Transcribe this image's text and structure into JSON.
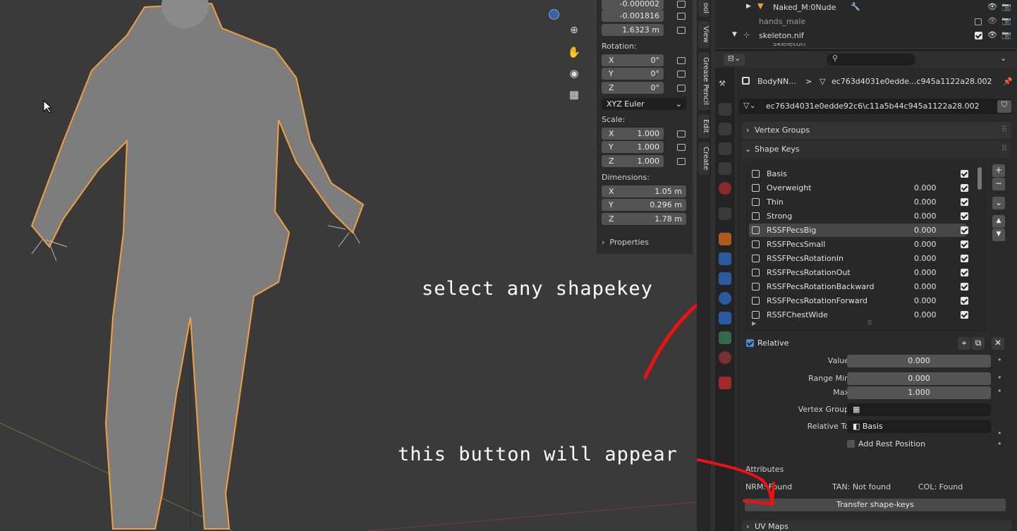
{
  "npanel": {
    "loc": [
      "-0.000002",
      "-0.001816",
      "1.6323 m"
    ],
    "rotation_label": "Rotation:",
    "rotation": [
      {
        "ax": "X",
        "v": "0°"
      },
      {
        "ax": "Y",
        "v": "0°"
      },
      {
        "ax": "Z",
        "v": "0°"
      }
    ],
    "rot_mode": "XYZ Euler",
    "scale_label": "Scale:",
    "scale": [
      {
        "ax": "X",
        "v": "1.000"
      },
      {
        "ax": "Y",
        "v": "1.000"
      },
      {
        "ax": "Z",
        "v": "1.000"
      }
    ],
    "dim_label": "Dimensions:",
    "dims": [
      {
        "ax": "X",
        "v": "1.05 m"
      },
      {
        "ax": "Y",
        "v": "0.296 m"
      },
      {
        "ax": "Z",
        "v": "1.78 m"
      }
    ],
    "properties": "Properties"
  },
  "vtabs": [
    "ool",
    "View",
    "Grease Pencil",
    "Edit",
    "Create"
  ],
  "outliner": [
    "Naked_M:0Nude",
    "hands_male",
    "skeleton.nif",
    "skeleton"
  ],
  "props": {
    "breadcrumb_obj": "BodyNN...",
    "breadcrumb_sep": ">",
    "breadcrumb_mesh": "ec763d4031e0edde...c945a1122a28.002",
    "mesh_name": "ec763d4031e0edde92c6\\c11a5b44c945a1122a28.002",
    "vertex_groups": "Vertex Groups",
    "shape_keys": "Shape Keys",
    "keys": [
      {
        "name": "Basis",
        "value": ""
      },
      {
        "name": "Overweight",
        "value": "0.000"
      },
      {
        "name": "Thin",
        "value": "0.000"
      },
      {
        "name": "Strong",
        "value": "0.000"
      },
      {
        "name": "RSSFPecsBig",
        "value": "0.000"
      },
      {
        "name": "RSSFPecsSmall",
        "value": "0.000"
      },
      {
        "name": "RSSFPecsRotationIn",
        "value": "0.000"
      },
      {
        "name": "RSSFPecsRotationOut",
        "value": "0.000"
      },
      {
        "name": "RSSFPecsRotationBackward",
        "value": "0.000"
      },
      {
        "name": "RSSFPecsRotationForward",
        "value": "0.000"
      },
      {
        "name": "RSSFChestWide",
        "value": "0.000"
      }
    ],
    "relative": "Relative",
    "value_label": "Value",
    "value": "0.000",
    "range_min_label": "Range Min",
    "range_min": "0.000",
    "max_label": "Max",
    "max": "1.000",
    "vgroup_label": "Vertex Group",
    "relative_to_label": "Relative To",
    "relative_to": "Basis",
    "add_rest": "Add Rest Position",
    "attributes": "Attributes",
    "nrm": "NRM: Found",
    "tan": "TAN: Not found",
    "col": "COL: Found",
    "transfer": "Transfer shape-keys",
    "uv_maps": "UV Maps"
  },
  "annotations": {
    "select": "select any shapekey",
    "appear": "this button will appear"
  }
}
